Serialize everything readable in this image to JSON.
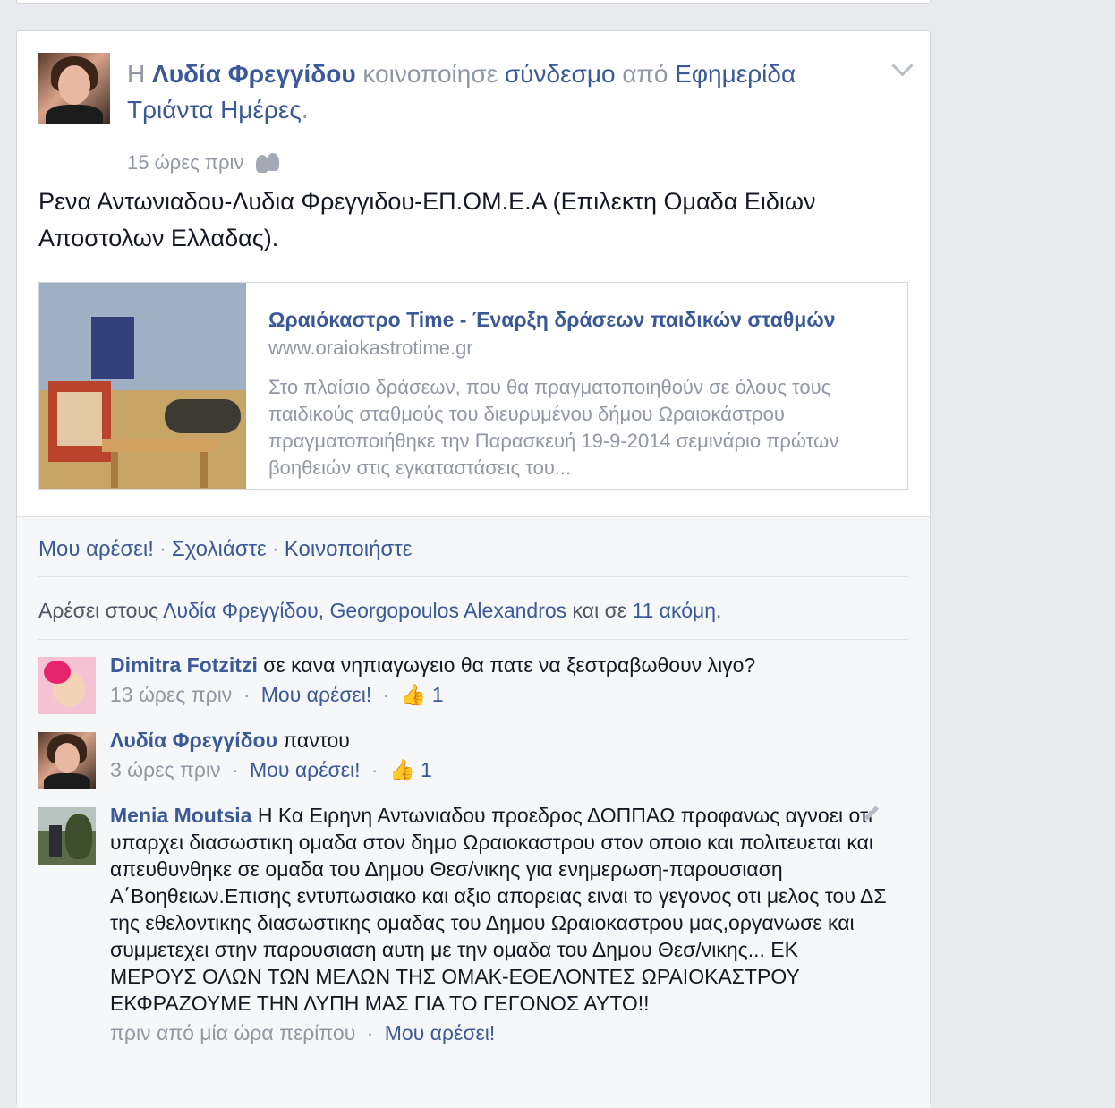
{
  "post": {
    "prefix": "Η",
    "author": "Λυδία Φρεγγίδου",
    "verb": "κοινοποίησε",
    "object": "σύνδεσμο",
    "from_word": "από",
    "source": "Εφημερίδα Τριάντα Ημέρες",
    "period": ".",
    "time": "15 ώρες πριν",
    "audience_icon": "friends-icon",
    "message": "Ρενα Αντωνιαδου-Λυδια Φρεγγιδου-ΕΠ.ΟΜ.Ε.Α (Επιλεκτη Ομαδα Ειδιων Αποστολων Ελλαδας).",
    "menu_icon": "chevron-down-icon"
  },
  "shared_link": {
    "title": "Ωραιόκαστρο Time - Έναρξη δράσεων παιδικών σταθμών",
    "domain": "www.oraiokastrotime.gr",
    "description": "Στο πλαίσιο δράσεων, που θα πραγματοποιηθούν σε όλους τους παιδικούς σταθμούς του διευρυμένου δήμου Ωραιοκάστρου πραγματοποιήθηκε την Παρασκευή 19-9-2014 σεμινάριο πρώτων βοηθειών στις εγκαταστάσεις του..."
  },
  "actions": {
    "like": "Μου αρέσει!",
    "comment": "Σχολιάστε",
    "share": "Κοινοποιήστε",
    "separator": "·"
  },
  "likes": {
    "prefix": "Αρέσει στους",
    "person1": "Λυδία Φρεγγίδου",
    "comma": ",",
    "person2": "Georgopoulos Alexandros",
    "and_word": "και σε",
    "others": "11 ακόμη",
    "period": "."
  },
  "comments": [
    {
      "author": "Dimitra Fotzitzi",
      "text": "σε κανα νηπιαγωγειο θα πατε να ξεστραβωθουν λιγο?",
      "time": "13 ώρες πριν",
      "like_label": "Μου αρέσει!",
      "like_count": "1"
    },
    {
      "author": "Λυδία Φρεγγίδου",
      "text": "παντου",
      "time": "3 ώρες πριν",
      "like_label": "Μου αρέσει!",
      "like_count": "1"
    },
    {
      "author": "Menia Moutsia",
      "text": "Η Κα Ειρηνη Αντωνιαδου προεδρος ΔΟΠΠΑΩ προφανως αγνοει οτι υπαρχει διασωστικη ομαδα στον δημο Ωραιοκαστρου στον οποιο και πολιτευεται και απευθυνθηκε σε ομαδα του Δημου Θεσ/νικης για ενημερωση-παρουσιαση Α΄Βοηθειων.Επισης εντυπωσιακο και αξιο απορειας ειναι το γεγονος οτι μελος του ΔΣ της εθελοντικης διασωστικης ομαδας του Δημου Ωραιοκαστρου μας,οργανωσε και συμμετεχει στην παρουσιαση αυτη με την ομαδα του Δημου Θεσ/νικης... ΕΚ ΜΕΡΟΥΣ ΟΛΩΝ ΤΩΝ ΜΕΛΩΝ ΤΗΣ ΟΜΑΚ-ΕΘΕΛΟΝΤΕΣ ΩΡΑΙΟΚΑΣΤΡΟΥ ΕΚΦΡΑΖΟΥΜΕ ΤΗΝ ΛΥΠΗ ΜΑΣ ΓΙΑ ΤΟ ΓΕΓΟΝΟΣ ΑΥΤΟ!!",
      "time": "πριν από μία ώρα περίπου",
      "like_label": "Μου αρέσει!"
    }
  ],
  "icons": {
    "thumb": "thumbs-up-icon",
    "edit": "pencil-icon"
  }
}
